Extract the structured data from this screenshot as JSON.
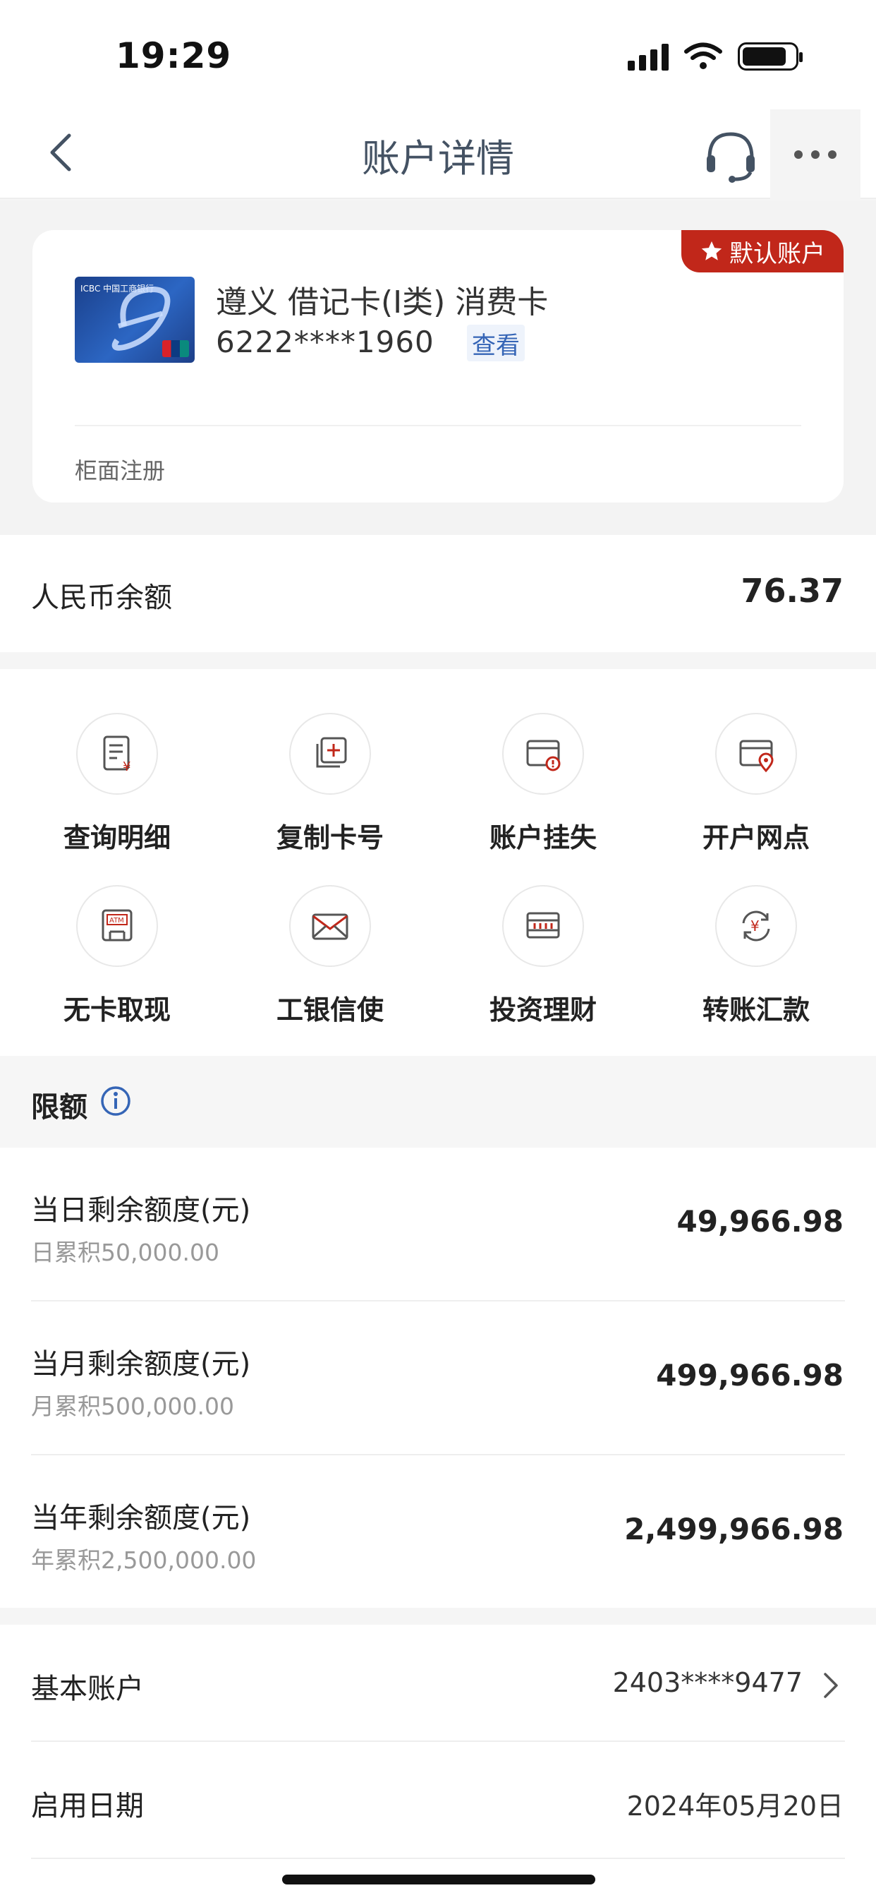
{
  "status": {
    "time": "19:29"
  },
  "nav": {
    "title": "账户详情"
  },
  "card": {
    "default_tag": "默认账户",
    "name": "遵义 借记卡(Ⅰ类) 消费卡",
    "number": "6222****1960",
    "view_label": "查看",
    "registration": "柜面注册",
    "brand_text": "ICBC 中国工商银行"
  },
  "balance": {
    "label": "人民币余额",
    "value": "76.37"
  },
  "functions": [
    {
      "label": "查询明细",
      "icon": "statement-icon"
    },
    {
      "label": "复制卡号",
      "icon": "copy-card-icon"
    },
    {
      "label": "账户挂失",
      "icon": "report-loss-icon"
    },
    {
      "label": "开户网点",
      "icon": "branch-location-icon"
    },
    {
      "label": "无卡取现",
      "icon": "atm-icon"
    },
    {
      "label": "工银信使",
      "icon": "envelope-icon"
    },
    {
      "label": "投资理财",
      "icon": "investment-icon"
    },
    {
      "label": "转账汇款",
      "icon": "transfer-icon"
    }
  ],
  "limits": {
    "title": "限额",
    "rows": [
      {
        "label": "当日剩余额度(元)",
        "sub": "日累积50,000.00",
        "value": "49,966.98"
      },
      {
        "label": "当月剩余额度(元)",
        "sub": "月累积500,000.00",
        "value": "499,966.98"
      },
      {
        "label": "当年剩余额度(元)",
        "sub": "年累积2,500,000.00",
        "value": "2,499,966.98"
      }
    ]
  },
  "info": {
    "basic_account_label": "基本账户",
    "basic_account_value": "2403****9477",
    "start_date_label": "启用日期",
    "start_date_value": "2024年05月20日"
  },
  "colors": {
    "accent_red": "#c1271a",
    "link_blue": "#3565b6"
  }
}
